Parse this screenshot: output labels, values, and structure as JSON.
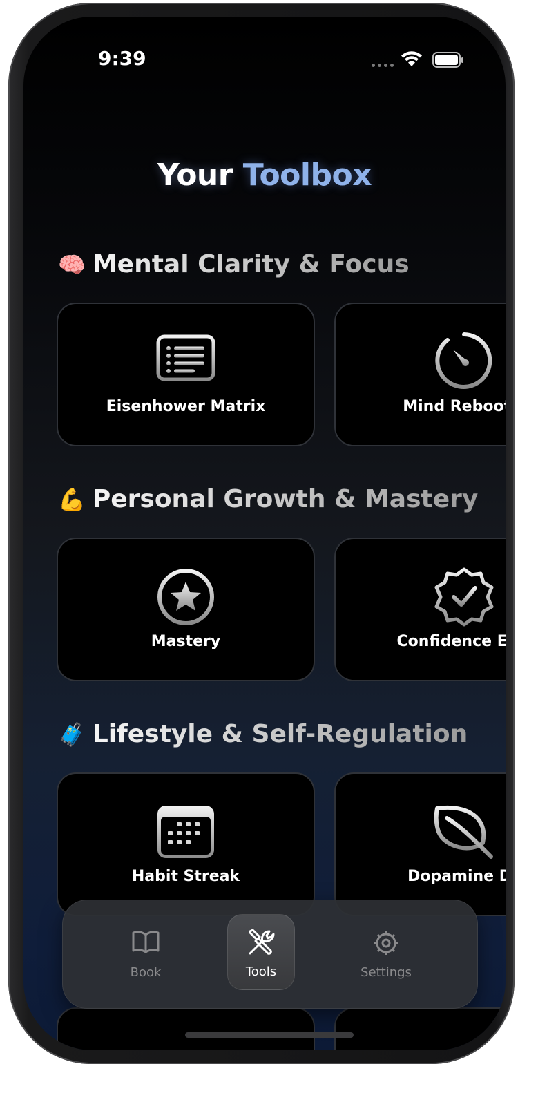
{
  "status_bar": {
    "time": "9:39"
  },
  "header": {
    "title_part1": "Your",
    "title_part2": "Toolbox"
  },
  "sections": [
    {
      "emoji": "🧠",
      "title": "Mental Clarity & Focus",
      "cards": [
        {
          "label": "Eisenhower Matrix",
          "icon": "list-icon"
        },
        {
          "label": "Mind Reboot T",
          "icon": "timer-icon"
        }
      ]
    },
    {
      "emoji": "💪",
      "title": "Personal Growth & Mastery",
      "cards": [
        {
          "label": "Mastery",
          "icon": "star-circle-icon"
        },
        {
          "label": "Confidence Eval",
          "icon": "checkmark-seal-icon"
        }
      ]
    },
    {
      "emoji": "🧳",
      "title": "Lifestyle & Self-Regulation",
      "cards": [
        {
          "label": "Habit Streak",
          "icon": "calendar-icon"
        },
        {
          "label": "Dopamine De",
          "icon": "leaf-icon"
        }
      ]
    }
  ],
  "tab_bar": {
    "tabs": [
      {
        "label": "Book",
        "icon": "book-icon",
        "active": false
      },
      {
        "label": "Tools",
        "icon": "tools-icon",
        "active": true
      },
      {
        "label": "Settings",
        "icon": "gear-icon",
        "active": false
      }
    ]
  },
  "colors": {
    "title_accent": "#8fb2ea",
    "card_background": "#000000",
    "card_border": "#2f3238"
  }
}
